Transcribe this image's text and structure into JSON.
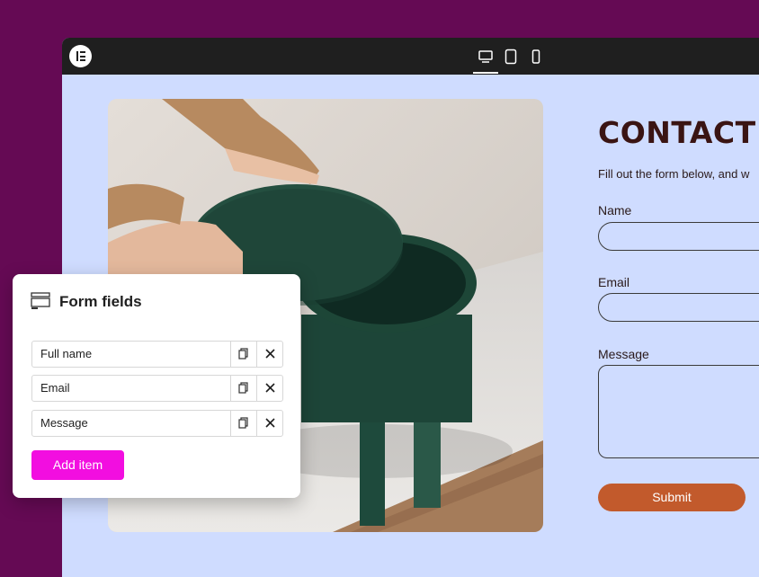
{
  "editor": {
    "devices": [
      "desktop",
      "tablet",
      "mobile"
    ],
    "active_device": "desktop"
  },
  "contact": {
    "heading": "CONTACT U",
    "subtitle": "Fill out the form below, and w",
    "fields": [
      {
        "label": "Name",
        "type": "text",
        "value": ""
      },
      {
        "label": "Email",
        "type": "text",
        "value": ""
      },
      {
        "label": "Message",
        "type": "textarea",
        "value": ""
      }
    ],
    "submit_label": "Submit"
  },
  "form_panel": {
    "title": "Form fields",
    "items": [
      {
        "label": "Full name"
      },
      {
        "label": "Email"
      },
      {
        "label": "Message"
      }
    ],
    "add_item_label": "Add item"
  },
  "colors": {
    "page_background": "#650a54",
    "canvas_background": "#cfdcff",
    "heading": "#3a1413",
    "submit": "#c25a2c",
    "add_item": "#f20ee0"
  }
}
